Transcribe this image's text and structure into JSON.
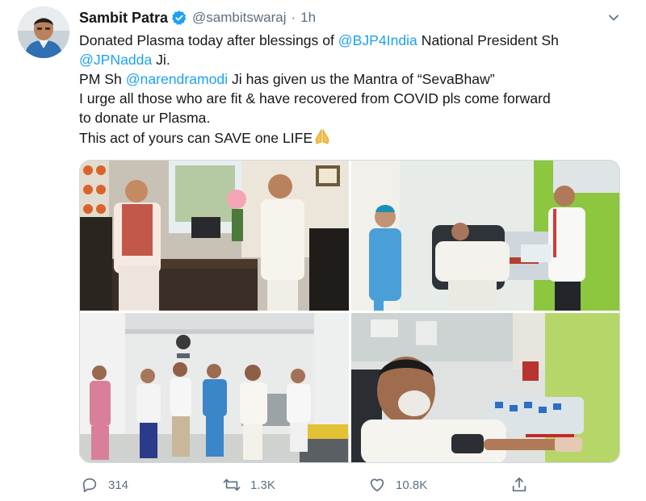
{
  "tweet": {
    "author_name": "Sambit Patra",
    "handle": "@sambitswaraj",
    "separator": "·",
    "time": "1h",
    "body": {
      "line1_text": "Donated Plasma today after blessings of ",
      "line1_mention": "@BJP4India",
      "line1_suffix": " National President Sh",
      "line2_mention": "@JPNadda",
      "line2_suffix": " Ji.",
      "line3_prefix": "PM Sh ",
      "line3_mention": "@narendramodi",
      "line3_suffix": " Ji has given us the Mantra of “SevaBhaw”",
      "line4": "I urge all those who are fit & have recovered from COVID pls come forward",
      "line5": "to donate ur Plasma.",
      "line6": "This act of yours can SAVE one LIFE"
    },
    "icons": {
      "verified": "verified-badge-icon",
      "caret": "chevron-down-icon",
      "pray": "folded-hands-icon",
      "reply": "reply-icon",
      "retweet": "retweet-icon",
      "like": "heart-icon",
      "share": "share-icon"
    },
    "actions": {
      "replies": "314",
      "retweets": "1.3K",
      "likes": "10.8K"
    },
    "colors": {
      "link": "#1da1f2",
      "muted": "#5b7083",
      "text": "#14171a",
      "verified": "#1da1f2"
    }
  }
}
